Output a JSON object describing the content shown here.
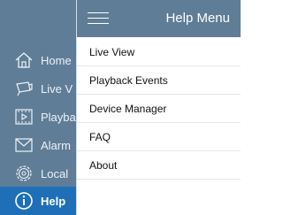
{
  "help_menu": {
    "title": "Help Menu",
    "items": [
      {
        "label": "Live View"
      },
      {
        "label": "Playback Events"
      },
      {
        "label": "Device Manager"
      },
      {
        "label": "FAQ"
      },
      {
        "label": "About"
      }
    ]
  },
  "sidebar": {
    "items": [
      {
        "label": "Home",
        "icon": "house-icon"
      },
      {
        "label": "Live V",
        "icon": "camera-icon"
      },
      {
        "label": "Playba",
        "icon": "film-icon"
      },
      {
        "label": "Alarm",
        "icon": "envelope-icon"
      },
      {
        "label": "Local",
        "icon": "gear-icon"
      },
      {
        "label": "Help",
        "icon": "info-icon",
        "active": true
      }
    ]
  },
  "colors": {
    "header_bg": "#5f7d96",
    "active_bg": "#1e6fb8",
    "menu_text": "#111111"
  }
}
